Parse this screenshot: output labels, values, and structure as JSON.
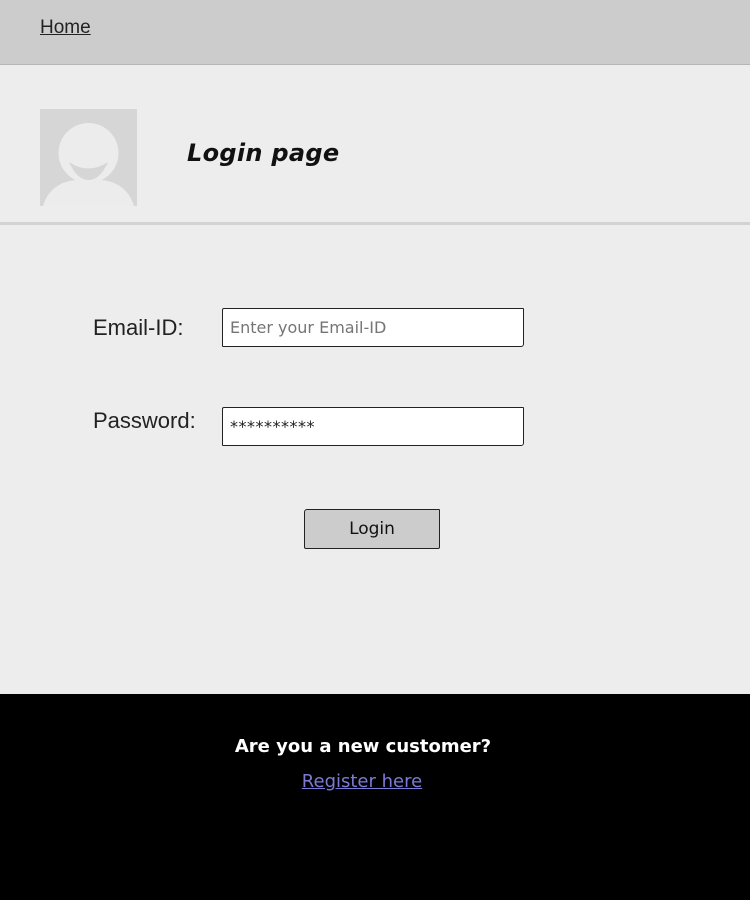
{
  "nav": {
    "home_label": "Home"
  },
  "header": {
    "title": "Login page",
    "avatar_icon": "user-avatar-placeholder"
  },
  "form": {
    "email_label": "Email-ID:",
    "email_placeholder": "Enter your Email-ID",
    "password_label": "Password:",
    "password_value": "**********",
    "login_label": "Login"
  },
  "footer": {
    "question": "Are you a new customer?",
    "register_label": "Register here"
  },
  "colors": {
    "topbar": "#cccccc",
    "page_bg": "#ededed",
    "footer_bg": "#000000",
    "link": "#7b7bd6"
  }
}
